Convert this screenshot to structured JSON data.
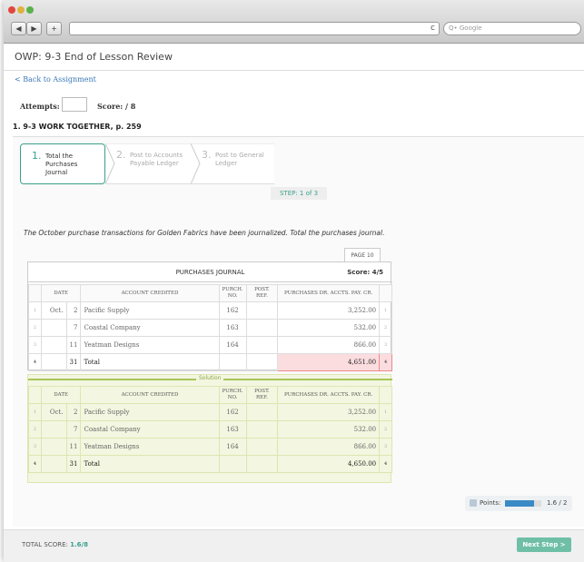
{
  "browser": {
    "search_placeholder": "Q• Google",
    "reload": "c",
    "back": "◀",
    "forward": "▶",
    "add": "+"
  },
  "page": {
    "title": "OWP: 9-3 End of Lesson Review",
    "back_link": "< Back to Assignment",
    "attempts_label": "Attempts:",
    "score_label": "Score: / 8",
    "work_heading": "1. 9-3 WORK TOGETHER, p. 259"
  },
  "steps": [
    {
      "num": "1.",
      "label": "Total the Purchases Journal"
    },
    {
      "num": "2.",
      "label": "Post to Accounts Payable Ledger"
    },
    {
      "num": "3.",
      "label": "Post to General Ledger"
    }
  ],
  "step_indicator": "STEP: 1 of 3",
  "instructions": "The October purchase transactions for Golden Fabrics have been journalized. Total the purchases journal.",
  "journal": {
    "page_tab": "PAGE 10",
    "title": "PURCHASES JOURNAL",
    "score": "Score: 4/5",
    "headers": {
      "date": "DATE",
      "account": "ACCOUNT CREDITED",
      "purch_no": "PURCH. NO.",
      "post_ref": "POST. REF.",
      "amount": "PURCHASES DR. ACCTS. PAY. CR."
    },
    "rows": [
      {
        "ln": "1",
        "month": "Oct.",
        "day": "2",
        "account": "Pacific Supply",
        "pno": "162",
        "amount": "3,252.00",
        "ln2": "1"
      },
      {
        "ln": "2",
        "month": "",
        "day": "7",
        "account": "Coastal Company",
        "pno": "163",
        "amount": "532.00",
        "ln2": "2"
      },
      {
        "ln": "3",
        "month": "",
        "day": "11",
        "account": "Yeatman Designs",
        "pno": "164",
        "amount": "866.00",
        "ln2": "3"
      },
      {
        "ln": "4",
        "month": "",
        "day": "31",
        "account": "Total",
        "pno": "",
        "amount": "4,651.00",
        "ln2": "4"
      }
    ]
  },
  "solution": {
    "label": "Solution",
    "rows": [
      {
        "ln": "1",
        "month": "Oct.",
        "day": "2",
        "account": "Pacific Supply",
        "pno": "162",
        "amount": "3,252.00",
        "ln2": "1"
      },
      {
        "ln": "2",
        "month": "",
        "day": "7",
        "account": "Coastal Company",
        "pno": "163",
        "amount": "532.00",
        "ln2": "2"
      },
      {
        "ln": "3",
        "month": "",
        "day": "11",
        "account": "Yeatman Designs",
        "pno": "164",
        "amount": "866.00",
        "ln2": "3"
      },
      {
        "ln": "4",
        "month": "",
        "day": "31",
        "account": "Total",
        "pno": "",
        "amount": "4,650.00",
        "ln2": "4"
      }
    ]
  },
  "points": {
    "label": "Points:",
    "value": "1.6 / 2",
    "fraction": 0.8
  },
  "footer": {
    "total_label": "TOTAL SCORE:",
    "total_value": "1.6/8",
    "next": "Next Step >"
  },
  "colors": {
    "accent": "#3aa08a",
    "error": "#fbdde0",
    "solution_bg": "#f3f6e0"
  }
}
